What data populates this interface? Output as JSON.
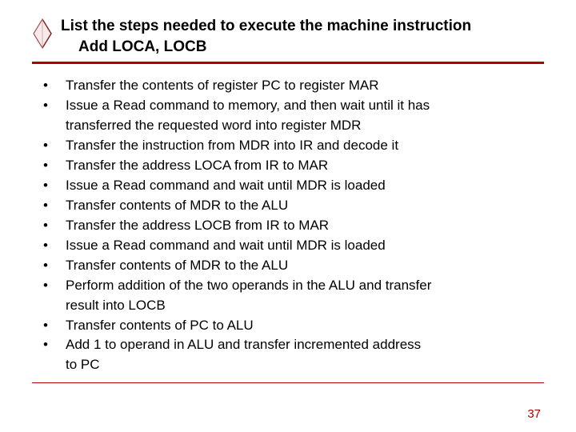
{
  "title": {
    "line1": "List the steps needed to execute the machine instruction",
    "line2": "Add LOCA, LOCB"
  },
  "bullets": [
    {
      "text": "Transfer the contents of register PC to register MAR"
    },
    {
      "text": "Issue a Read command to memory, and then wait until it has",
      "cont": "transferred the requested word into register MDR"
    },
    {
      "text": "Transfer the instruction from MDR into IR and decode it"
    },
    {
      "text": "Transfer the address LOCA from IR to MAR"
    },
    {
      "text": "Issue a Read command and wait until MDR is loaded"
    },
    {
      "text": "Transfer contents of MDR to the ALU"
    },
    {
      "text": "Transfer the address LOCB from IR to MAR"
    },
    {
      "text": "Issue a Read command and wait until MDR is loaded"
    },
    {
      "text": "Transfer contents of MDR to the ALU"
    },
    {
      "text": "Perform addition of the two operands in the ALU and transfer",
      "cont": "result  into LOCB"
    },
    {
      "text": "Transfer contents of PC to ALU"
    },
    {
      "text": "Add 1 to operand in ALU and transfer incremented address",
      "cont": "to PC"
    }
  ],
  "page_number": "37"
}
